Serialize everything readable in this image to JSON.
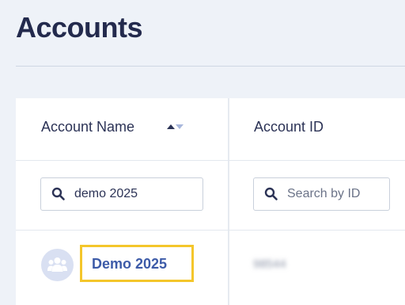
{
  "page": {
    "title": "Accounts"
  },
  "table": {
    "columns": [
      {
        "label": "Account Name",
        "sort": "ascending"
      },
      {
        "label": "Account ID"
      }
    ],
    "filters": {
      "name_value": "demo 2025",
      "id_placeholder": "Search by ID"
    },
    "rows": [
      {
        "name": "Demo 2025",
        "id": "98544",
        "avatar_icon": "group-icon"
      }
    ]
  },
  "colors": {
    "accent_link": "#3d5ba8",
    "highlight": "#f4c62b",
    "title": "#232a4d"
  }
}
